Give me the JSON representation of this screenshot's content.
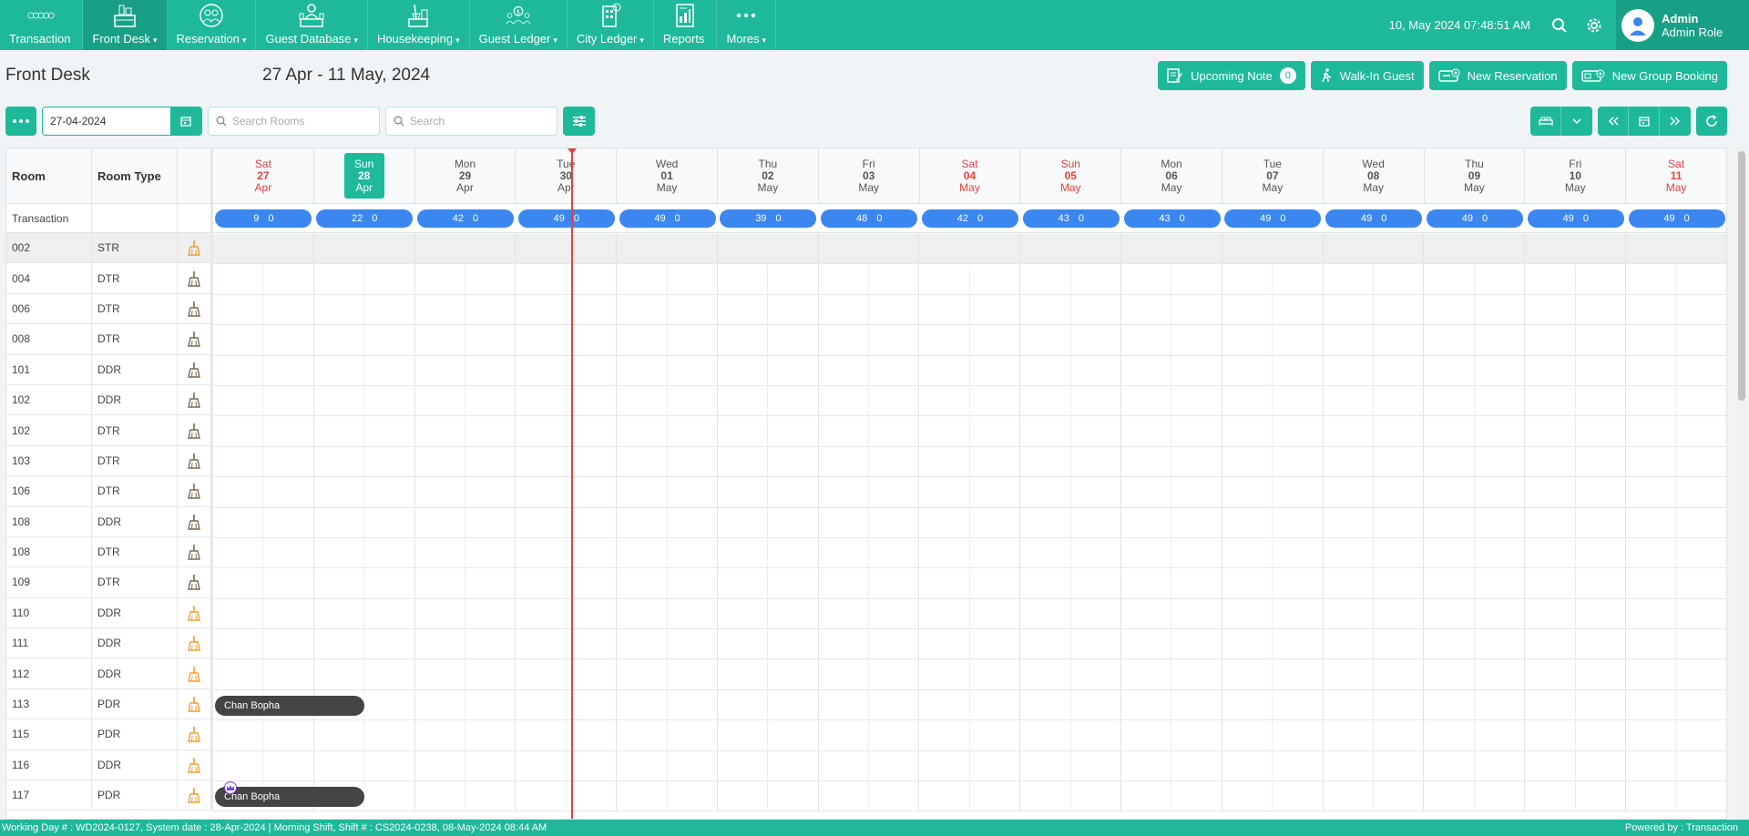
{
  "nav": {
    "items": [
      {
        "label": "Transaction",
        "caret": "",
        "icon": "transaction-icon"
      },
      {
        "label": "Front Desk",
        "caret": "▾",
        "icon": "front-desk-icon"
      },
      {
        "label": "Reservation",
        "caret": "▾",
        "icon": "reservation-icon"
      },
      {
        "label": "Guest Database",
        "caret": "▾",
        "icon": "guest-database-icon"
      },
      {
        "label": "Housekeeping",
        "caret": "▾",
        "icon": "housekeeping-icon"
      },
      {
        "label": "Guest Ledger",
        "caret": "▾",
        "icon": "guest-ledger-icon"
      },
      {
        "label": "City Ledger",
        "caret": "▾",
        "icon": "city-ledger-icon"
      },
      {
        "label": "Reports",
        "caret": "",
        "icon": "reports-icon"
      },
      {
        "label": "Mores",
        "caret": "▾",
        "icon": "more-dots-icon"
      }
    ],
    "datetime": "10, May 2024 07:48:51 AM",
    "user": {
      "name": "Admin",
      "role": "Admin Role"
    }
  },
  "page": {
    "title": "Front Desk",
    "date_range": "27 Apr - 11 May, 2024"
  },
  "actions": {
    "upcoming_note": "Upcoming Note",
    "upcoming_count": "0",
    "walk_in": "Walk-In Guest",
    "new_reservation": "New Reservation",
    "new_group": "New Group Booking"
  },
  "toolbar": {
    "date_value": "27-04-2024",
    "search_rooms_placeholder": "Search Rooms",
    "search_placeholder": "Search"
  },
  "grid": {
    "headers": {
      "room": "Room",
      "room_type": "Room Type"
    },
    "avail_label": "Transaction",
    "days": [
      {
        "dow": "Sat",
        "num": "27",
        "mon": "Apr",
        "weekend": true,
        "today": false,
        "avail": "9",
        "blocked": "0"
      },
      {
        "dow": "Sun",
        "num": "28",
        "mon": "Apr",
        "weekend": true,
        "today": true,
        "avail": "22",
        "blocked": "0"
      },
      {
        "dow": "Mon",
        "num": "29",
        "mon": "Apr",
        "weekend": false,
        "today": false,
        "avail": "42",
        "blocked": "0"
      },
      {
        "dow": "Tue",
        "num": "30",
        "mon": "Apr",
        "weekend": false,
        "today": false,
        "avail": "49",
        "blocked": "0"
      },
      {
        "dow": "Wed",
        "num": "01",
        "mon": "May",
        "weekend": false,
        "today": false,
        "avail": "49",
        "blocked": "0"
      },
      {
        "dow": "Thu",
        "num": "02",
        "mon": "May",
        "weekend": false,
        "today": false,
        "avail": "39",
        "blocked": "0"
      },
      {
        "dow": "Fri",
        "num": "03",
        "mon": "May",
        "weekend": false,
        "today": false,
        "avail": "48",
        "blocked": "0"
      },
      {
        "dow": "Sat",
        "num": "04",
        "mon": "May",
        "weekend": true,
        "today": false,
        "avail": "42",
        "blocked": "0"
      },
      {
        "dow": "Sun",
        "num": "05",
        "mon": "May",
        "weekend": true,
        "today": false,
        "avail": "43",
        "blocked": "0"
      },
      {
        "dow": "Mon",
        "num": "06",
        "mon": "May",
        "weekend": false,
        "today": false,
        "avail": "43",
        "blocked": "0"
      },
      {
        "dow": "Tue",
        "num": "07",
        "mon": "May",
        "weekend": false,
        "today": false,
        "avail": "49",
        "blocked": "0"
      },
      {
        "dow": "Wed",
        "num": "08",
        "mon": "May",
        "weekend": false,
        "today": false,
        "avail": "49",
        "blocked": "0"
      },
      {
        "dow": "Thu",
        "num": "09",
        "mon": "May",
        "weekend": false,
        "today": false,
        "avail": "49",
        "blocked": "0"
      },
      {
        "dow": "Fri",
        "num": "10",
        "mon": "May",
        "weekend": false,
        "today": false,
        "avail": "49",
        "blocked": "0"
      },
      {
        "dow": "Sat",
        "num": "11",
        "mon": "May",
        "weekend": true,
        "today": false,
        "avail": "49",
        "blocked": "0"
      }
    ],
    "rooms": [
      {
        "room": "002",
        "type": "STR",
        "status": "dirty"
      },
      {
        "room": "004",
        "type": "DTR",
        "status": "clean"
      },
      {
        "room": "006",
        "type": "DTR",
        "status": "clean"
      },
      {
        "room": "008",
        "type": "DTR",
        "status": "clean"
      },
      {
        "room": "101",
        "type": "DDR",
        "status": "clean"
      },
      {
        "room": "102",
        "type": "DDR",
        "status": "clean"
      },
      {
        "room": "102",
        "type": "DTR",
        "status": "clean"
      },
      {
        "room": "103",
        "type": "DTR",
        "status": "clean"
      },
      {
        "room": "106",
        "type": "DTR",
        "status": "clean"
      },
      {
        "room": "108",
        "type": "DDR",
        "status": "clean"
      },
      {
        "room": "108",
        "type": "DTR",
        "status": "clean"
      },
      {
        "room": "109",
        "type": "DTR",
        "status": "clean"
      },
      {
        "room": "110",
        "type": "DDR",
        "status": "dirty"
      },
      {
        "room": "111",
        "type": "DDR",
        "status": "dirty"
      },
      {
        "room": "112",
        "type": "DDR",
        "status": "dirty"
      },
      {
        "room": "113",
        "type": "PDR",
        "status": "dirty"
      },
      {
        "room": "115",
        "type": "PDR",
        "status": "dirty"
      },
      {
        "room": "116",
        "type": "DDR",
        "status": "dirty"
      },
      {
        "room": "117",
        "type": "PDR",
        "status": "dirty"
      }
    ],
    "bookings": [
      {
        "guest": "Chan Bopha",
        "room": "113",
        "start_day": 0,
        "nights": 1.5,
        "vip": false
      },
      {
        "guest": "Chan Bopha",
        "room": "117",
        "start_day": 0,
        "nights": 1.5,
        "vip": true
      }
    ],
    "colors": {
      "clean": "#7a6a55",
      "dirty": "#f0a030",
      "accent": "#1db99a",
      "pill": "#3b86ef",
      "weekend": "#e8403d"
    }
  },
  "status_bar": {
    "left": "Working Day # : WD2024-0127, System date : 28-Apr-2024 | Morning Shift, Shift # : CS2024-0238, 08-May-2024 08:44 AM",
    "right": "Powered by : Transaction"
  }
}
